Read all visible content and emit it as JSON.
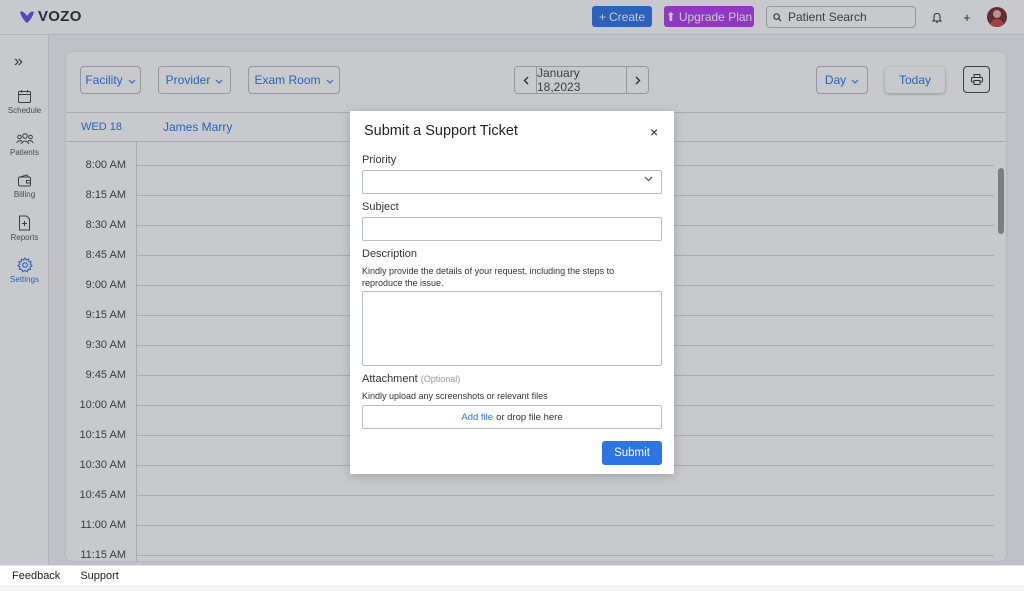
{
  "brand": {
    "name": "VOZO",
    "color": "#6c4ef5"
  },
  "topbar": {
    "create_label": "Create",
    "upgrade_label": "Upgrade Plan",
    "search_placeholder": "Patient Search"
  },
  "sidebar": {
    "items": [
      {
        "label": "Schedule",
        "icon": "calendar-icon"
      },
      {
        "label": "Patients",
        "icon": "patients-icon"
      },
      {
        "label": "Billing",
        "icon": "wallet-icon"
      },
      {
        "label": "Reports",
        "icon": "report-icon"
      },
      {
        "label": "Settings",
        "icon": "gear-icon",
        "active": true
      }
    ]
  },
  "schedule": {
    "filters": [
      "Facility",
      "Provider",
      "Exam Room"
    ],
    "date": "January 18,2023",
    "view": "Day",
    "today_label": "Today",
    "day_header": "WED 18",
    "provider": "James Marry",
    "times": [
      "8:00 AM",
      "8:15 AM",
      "8:30 AM",
      "8:45 AM",
      "9:00 AM",
      "9:15 AM",
      "9:30 AM",
      "9:45 AM",
      "10:00 AM",
      "10:15 AM",
      "10:30 AM",
      "10:45 AM",
      "11:00 AM",
      "11:15 AM"
    ]
  },
  "modal": {
    "title": "Submit a Support Ticket",
    "close": "×",
    "priority_label": "Priority",
    "priority_value": "",
    "subject_label": "Subject",
    "subject_value": "",
    "description_label": "Description",
    "description_hint": "Kindly provide the details of your request, including the steps to reproduce the issue.",
    "description_value": "",
    "attachment_label": "Attachment",
    "attachment_optional": "(Optional)",
    "attachment_hint": "Kindly upload any screenshots or relevant files",
    "add_file": "Add file",
    "drop_text": "or drop file here",
    "submit_label": "Submit"
  },
  "footer": {
    "feedback": "Feedback",
    "support": "Support"
  },
  "colors": {
    "accent": "#2f74e5",
    "upgrade": "#b43cf0"
  }
}
